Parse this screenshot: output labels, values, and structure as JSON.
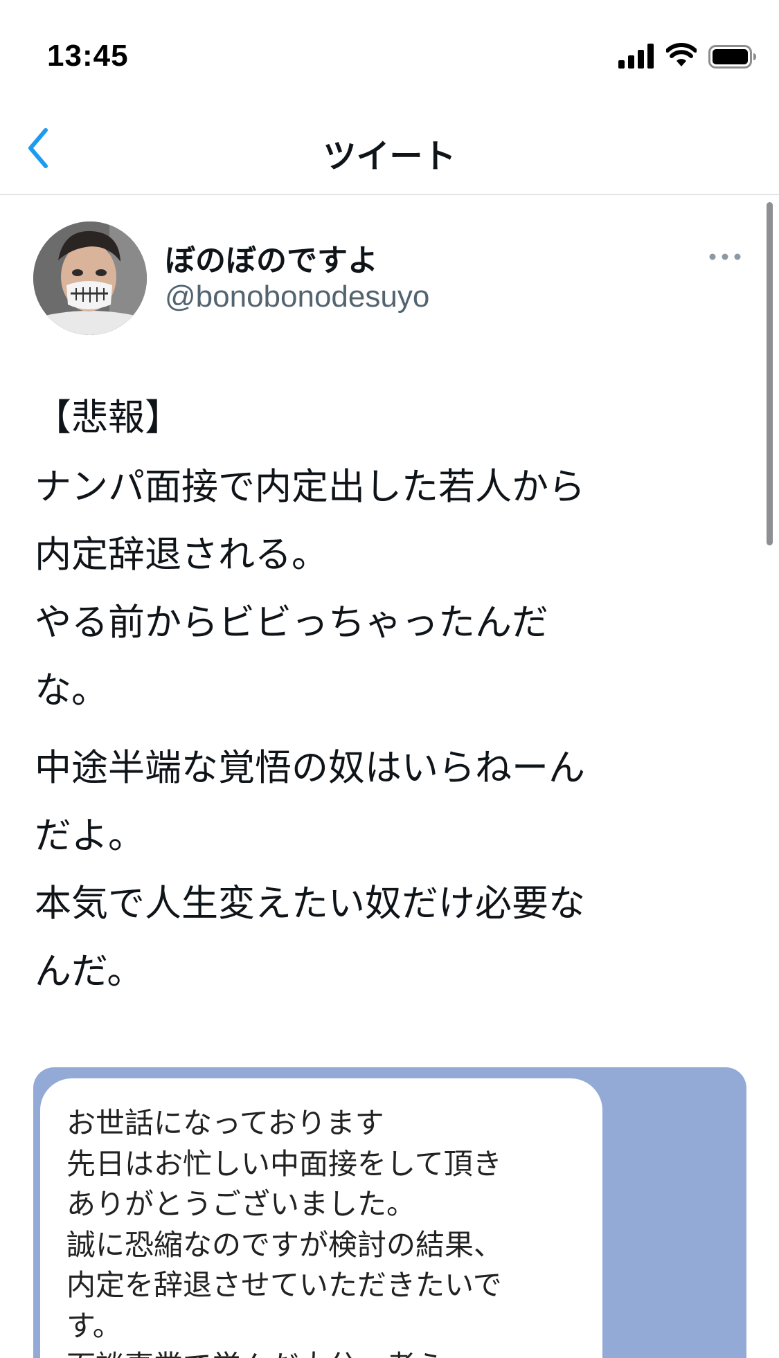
{
  "status_bar": {
    "time": "13:45",
    "icons": [
      "signal-icon",
      "wifi-icon",
      "battery-icon"
    ]
  },
  "header": {
    "back_icon": "chevron-left-icon",
    "title": "ツイート"
  },
  "tweet": {
    "author": {
      "display_name": "ぼのぼのですよ",
      "username": "@bonobonodesuyo",
      "avatar": "avatar-photo"
    },
    "more_icon": "more-horizontal-icon",
    "paragraphs": [
      "【悲報】",
      "ナンパ面接で内定出した若人から\n内定辞退される。\nやる前からビビっちゃったんだ\nな。",
      "中途半端な覚悟の奴はいらねーん\nだよ。\n本気で人生変えたい奴だけ必要な\nんだ。"
    ],
    "media": {
      "chat_message": "お世話になっております\n先日はお忙しい中面接をして頂き\nありがとうございました。\n誠に恐縮なのですが検討の結果、\n内定を辞退させていただきたいで\nす。\n面談事業で学んだ大分。者ら"
    }
  },
  "colors": {
    "accent": "#1d9bf0",
    "text_primary": "#0f1419",
    "text_secondary": "#536471",
    "divider": "#e1e5e8",
    "chat_background": "#94aad6"
  }
}
